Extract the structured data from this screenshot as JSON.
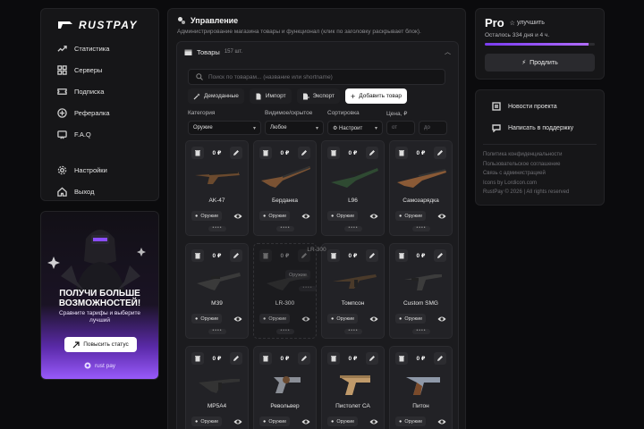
{
  "brand": {
    "name": "RUSTPAY"
  },
  "sidebar": {
    "items": [
      {
        "label": "Статистика",
        "icon": "chart-icon"
      },
      {
        "label": "Серверы",
        "icon": "servers-icon"
      },
      {
        "label": "Подписка",
        "icon": "ticket-icon"
      },
      {
        "label": "Рефералка",
        "icon": "gift-icon"
      },
      {
        "label": "F.A.Q",
        "icon": "help-icon"
      }
    ],
    "bottom_items": [
      {
        "label": "Настройки",
        "icon": "gear-icon"
      },
      {
        "label": "Выход",
        "icon": "home-icon"
      }
    ]
  },
  "promo": {
    "title": "ПОЛУЧИ БОЛЬШЕ ВОЗМОЖНОСТЕЙ!",
    "subtitle": "Сравните тарифы и выберите лучший",
    "button": "Повысить статус",
    "brand": "rust pay"
  },
  "main": {
    "title": "Управление",
    "description": "Администрирование магазина товары и функционал (клик по заголовку раскрывает блок).",
    "section": {
      "title": "Товары",
      "count": "157 шт."
    },
    "search_placeholder": "Поиск по товарам... (название или shortname)",
    "actions": {
      "demo": "Демоданные",
      "import": "Импорт",
      "export": "Экспорт",
      "add": "Добавить товар"
    },
    "filters": {
      "category_label": "Категория",
      "category_value": "Оружие",
      "visibility_label": "Видимое/скрытое",
      "visibility_value": "Любое",
      "sort_label": "Сортировка",
      "sort_value": "Настроит",
      "price_label": "Цена, ₽",
      "from_placeholder": "от",
      "to_placeholder": "до"
    },
    "products": [
      {
        "name": "AK-47",
        "price": "0 ₽",
        "tag": "Оружие"
      },
      {
        "name": "Берданка",
        "price": "0 ₽",
        "tag": "Оружие"
      },
      {
        "name": "L96",
        "price": "0 ₽",
        "tag": "Оружие"
      },
      {
        "name": "Самозарядка",
        "price": "0 ₽",
        "tag": "Оружие"
      },
      {
        "name": "M39",
        "price": "0 ₽",
        "tag": "Оружие"
      },
      {
        "name": "LR-300",
        "price": "0 ₽",
        "tag": "Оружие"
      },
      {
        "name": "Томпсон",
        "price": "0 ₽",
        "tag": "Оружие"
      },
      {
        "name": "Custom SMG",
        "price": "0 ₽",
        "tag": "Оружие"
      },
      {
        "name": "MP5A4",
        "price": "0 ₽",
        "tag": "Оружие"
      },
      {
        "name": "Револьвер",
        "price": "0 ₽",
        "tag": "Оружие"
      },
      {
        "name": "Пистолет СА",
        "price": "0 ₽",
        "tag": "Оружие"
      },
      {
        "name": "Питон",
        "price": "0 ₽",
        "tag": "Оружие"
      }
    ],
    "dragging": {
      "name": "LR-300",
      "tag": "Оружие"
    }
  },
  "pro": {
    "name": "Pro",
    "upgrade": "улучшить",
    "remaining": "Осталось 334 дня и 4 ч.",
    "progress": 0.94,
    "extend": "Продлить"
  },
  "links": {
    "news": "Новости проекта",
    "support": "Написать в поддержку",
    "footer": [
      "Политика конфиденциальности",
      "Пользовательское соглашение",
      "Связь с администрацией",
      "Icons by Lordicon.com",
      "RustPay © 2026 | All rights reserved"
    ]
  },
  "colors": {
    "accent": "#9b5cff",
    "background": "#0b0b0d",
    "card": "#161618"
  }
}
